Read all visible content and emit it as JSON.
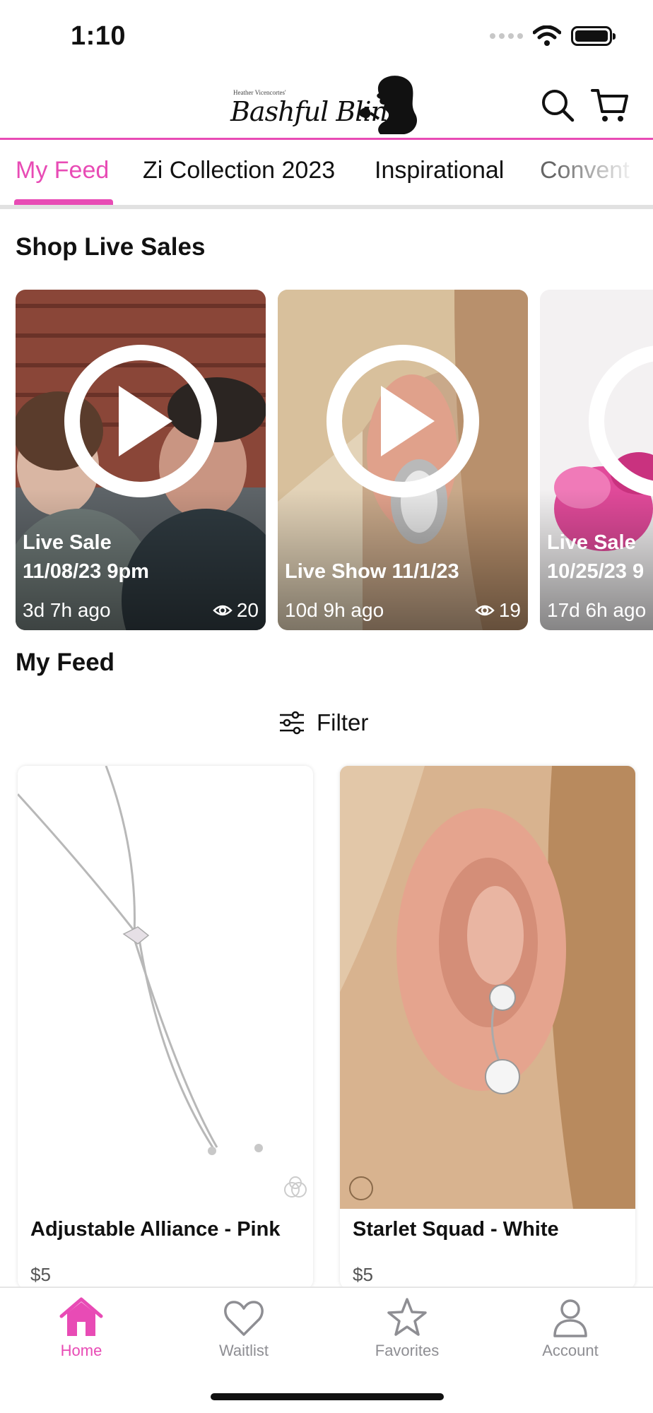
{
  "status_bar": {
    "time": "1:10"
  },
  "header": {
    "logo_tagline": "Heather Vicencortes'",
    "logo_text": "Bashful Bling",
    "search_icon": "search-icon",
    "cart_icon": "cart-icon"
  },
  "tabs": [
    {
      "label": "My Feed",
      "active": true
    },
    {
      "label": "Zi Collection 2023",
      "active": false
    },
    {
      "label": "Inspirational",
      "active": false
    },
    {
      "label": "Convent",
      "active": false
    }
  ],
  "live_sales": {
    "title": "Shop Live Sales",
    "cards": [
      {
        "title": "Live Sale\n11/08/23 9pm",
        "ago": "3d 7h ago",
        "views": "20"
      },
      {
        "title": "Live Show 11/1/23",
        "ago": "10d 9h ago",
        "views": "19"
      },
      {
        "title": "Live Sale\n10/25/23 9",
        "ago": "17d 6h ago",
        "views": ""
      }
    ]
  },
  "feed": {
    "title": "My Feed",
    "filter_label": "Filter",
    "products": [
      {
        "name": "Adjustable Alliance - Pink",
        "price": "$5"
      },
      {
        "name": "Starlet Squad - White",
        "price": "$5"
      }
    ]
  },
  "bottom_nav": [
    {
      "label": "Home",
      "icon": "home-icon",
      "active": true
    },
    {
      "label": "Waitlist",
      "icon": "heart-icon",
      "active": false
    },
    {
      "label": "Favorites",
      "icon": "star-icon",
      "active": false
    },
    {
      "label": "Account",
      "icon": "person-icon",
      "active": false
    }
  ],
  "colors": {
    "accent": "#e84bb5",
    "inactive": "#8e8e93"
  }
}
